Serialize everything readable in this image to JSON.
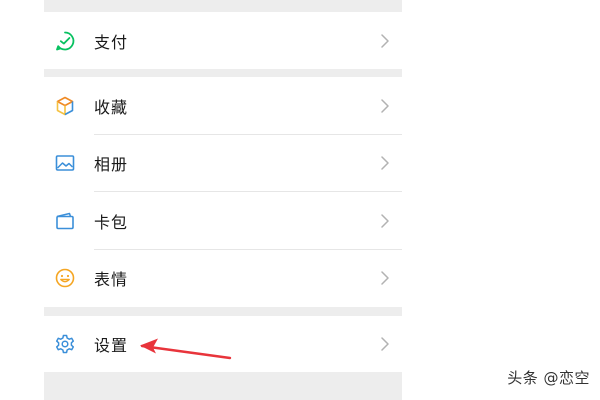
{
  "menu": {
    "payment": {
      "label": "支付",
      "icon": "payment-icon"
    },
    "favorites": {
      "label": "收藏",
      "icon": "cube-icon"
    },
    "album": {
      "label": "相册",
      "icon": "image-icon"
    },
    "card_wallet": {
      "label": "卡包",
      "icon": "wallet-icon"
    },
    "stickers": {
      "label": "表情",
      "icon": "smiley-icon"
    },
    "settings": {
      "label": "设置",
      "icon": "gear-icon"
    }
  },
  "watermark": "头条 @恋空",
  "colors": {
    "background": "#ededed",
    "row_background": "#ffffff",
    "payment_green": "#07c160",
    "icon_blue": "#3b8fd9",
    "sticker_orange": "#f5a623",
    "chevron": "#b2b2b2",
    "annotation_red": "#e8343b"
  }
}
